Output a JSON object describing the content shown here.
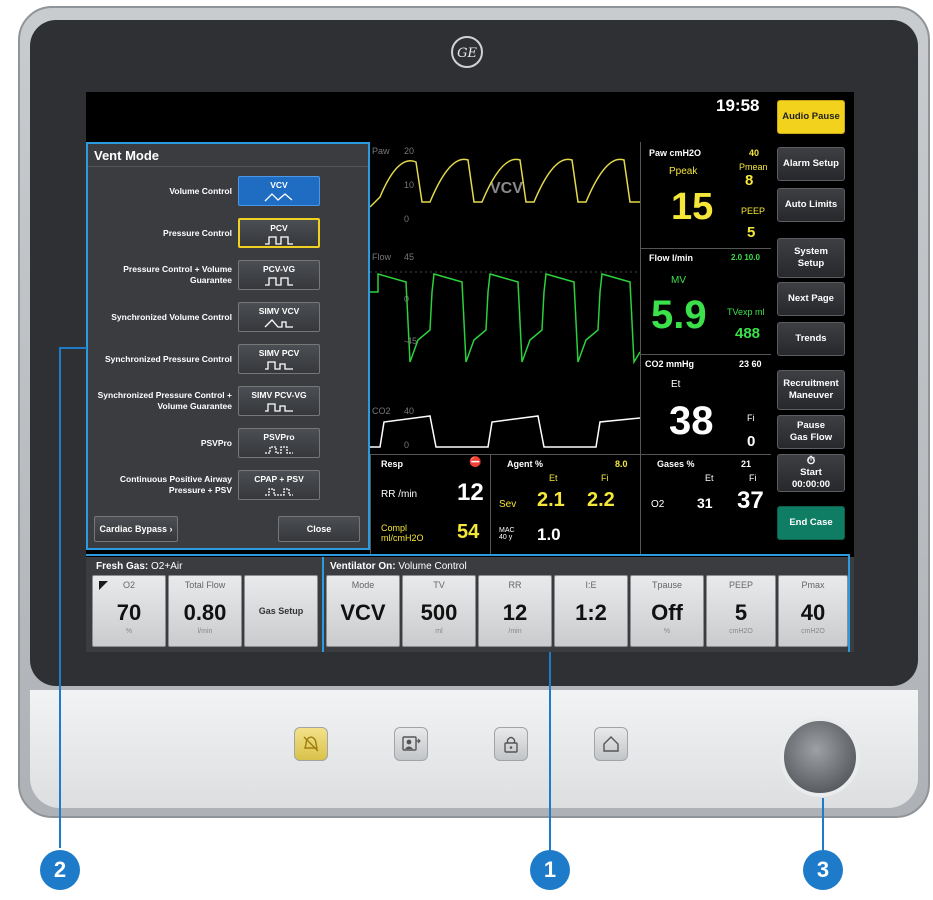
{
  "brand_logo": "GE",
  "screen": {
    "clock": "19:58",
    "side_buttons": [
      "Audio Pause",
      "Alarm Setup",
      "Auto Limits",
      "System Setup",
      "Next Page",
      "Trends",
      "Recruitment Maneuver",
      "Pause Gas Flow",
      "End Case"
    ],
    "timer": {
      "label": "Start",
      "value": "00:00:00"
    },
    "waveforms": {
      "paw": {
        "label": "Paw",
        "ticks": [
          "20",
          "10",
          "0"
        ],
        "overlay": "VCV"
      },
      "flow": {
        "label": "Flow",
        "ticks": [
          "45",
          "0",
          "-45"
        ]
      },
      "co2": {
        "label": "CO2",
        "ticks": [
          "40",
          "0"
        ]
      }
    },
    "paw_panel": {
      "title": "Paw cmH2O",
      "limit": "40",
      "ppeak_label": "Ppeak",
      "ppeak": "15",
      "pmean_label": "Pmean",
      "pmean": "8",
      "peep_label": "PEEP",
      "peep": "5"
    },
    "flow_panel": {
      "title": "Flow l/min",
      "limits": "2.0 10.0",
      "mv_label": "MV",
      "mv": "5.9",
      "tvexp_label": "TVexp ml",
      "tvexp": "488"
    },
    "co2_panel": {
      "title": "CO2 mmHg",
      "limits": "23 60",
      "et_label": "Et",
      "et": "38",
      "fi_label": "Fi",
      "fi": "0"
    },
    "resp_panel": {
      "title": "Resp",
      "rr_label": "RR /min",
      "rr": "12",
      "compl_label": "Compl ml/cmH2O",
      "compl": "54"
    },
    "agent_panel": {
      "title": "Agent %",
      "limit": "8.0",
      "et_label": "Et",
      "fi_label": "Fi",
      "agent": "Sev",
      "et": "2.1",
      "fi": "2.2",
      "mac_label": "MAC 40 y",
      "mac": "1.0"
    },
    "gases_panel": {
      "title": "Gases %",
      "limit": "21",
      "et_label": "Et",
      "fi_label": "Fi",
      "gas": "O2",
      "et": "31",
      "fi": "37"
    }
  },
  "vent_mode": {
    "title": "Vent Mode",
    "modes": [
      {
        "label": "Volume Control",
        "button": "VCV"
      },
      {
        "label": "Pressure Control",
        "button": "PCV"
      },
      {
        "label": "Pressure Control + Volume Guarantee",
        "button": "PCV-VG"
      },
      {
        "label": "Synchronized Volume Control",
        "button": "SIMV VCV"
      },
      {
        "label": "Synchronized Pressure Control",
        "button": "SIMV PCV"
      },
      {
        "label": "Synchronized Pressure Control + Volume Guarantee",
        "button": "SIMV PCV-VG"
      },
      {
        "label": "PSVPro",
        "button": "PSVPro"
      },
      {
        "label": "Continuous Positive Airway Pressure + PSV",
        "button": "CPAP + PSV"
      }
    ],
    "cardiac_bypass": "Cardiac Bypass",
    "close": "Close"
  },
  "fresh_gas": {
    "header_bold": "Fresh Gas:",
    "header_value": "O2+Air",
    "tiles": [
      {
        "label": "O2",
        "value": "70",
        "unit": "%"
      },
      {
        "label": "Total Flow",
        "value": "0.80",
        "unit": "l/min"
      }
    ],
    "gas_setup": "Gas Setup"
  },
  "ventilator": {
    "header_bold": "Ventilator On:",
    "header_value": "Volume Control",
    "tiles": [
      {
        "label": "Mode",
        "value": "VCV",
        "unit": ""
      },
      {
        "label": "TV",
        "value": "500",
        "unit": "ml"
      },
      {
        "label": "RR",
        "value": "12",
        "unit": "/min"
      },
      {
        "label": "I:E",
        "value": "1:2",
        "unit": ""
      },
      {
        "label": "Tpause",
        "value": "Off",
        "unit": "%"
      },
      {
        "label": "PEEP",
        "value": "5",
        "unit": "cmH2O"
      },
      {
        "label": "Pmax",
        "value": "40",
        "unit": "cmH2O"
      }
    ]
  },
  "hardware_keys": [
    "alarm-silence-icon",
    "screen-switch-icon",
    "lock-icon",
    "home-icon"
  ],
  "callouts": [
    "1",
    "2",
    "3"
  ],
  "colors": {
    "highlight_blue": "#2b9be0",
    "audio_pause": "#f2d21c",
    "end_case": "#0f7d63",
    "paw_wave": "#e2d94c",
    "flow_wave": "#2bd13a",
    "co2_wave": "#ffffff",
    "value_yellow": "#f5e63a",
    "value_green": "#3be04a",
    "callout": "#1e7bc9"
  }
}
